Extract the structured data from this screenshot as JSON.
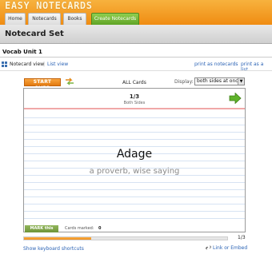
{
  "app": {
    "logo": "EASY NOTECARDS"
  },
  "nav": {
    "tabs": [
      {
        "label": "Home"
      },
      {
        "label": "Notecards"
      },
      {
        "label": "Books"
      },
      {
        "label": "Create Notecards"
      }
    ]
  },
  "page": {
    "title": "Notecard Set",
    "set_name": "Vocab Unit 1"
  },
  "view": {
    "notecard_view": "Notecard view",
    "separator": "|",
    "list_view": "List view",
    "print_notecards": "print as notecards",
    "print_list": "print as a list"
  },
  "controls": {
    "start_over": "START OVER",
    "shuffle_icon": "shuffle-icon",
    "all_cards": "ALL Cards",
    "display_label": "Display:",
    "display_value": "both sides at once",
    "display_arrow": "▼"
  },
  "card": {
    "counter": "1/3",
    "sides": "Both Sides",
    "term": "Adage",
    "definition": "a proverb, wise saying",
    "mark_button": "MARK this card",
    "marked_label": "Cards marked:",
    "marked_count": "0"
  },
  "progress": {
    "fraction": 0.33,
    "label": "1/3"
  },
  "footer": {
    "shortcuts": "Show keyboard shortcuts",
    "link_embed": "Link or Embed"
  },
  "colors": {
    "accent": "#f08c12",
    "link": "#2b63b5",
    "next_arrow": "#5fb32a"
  }
}
